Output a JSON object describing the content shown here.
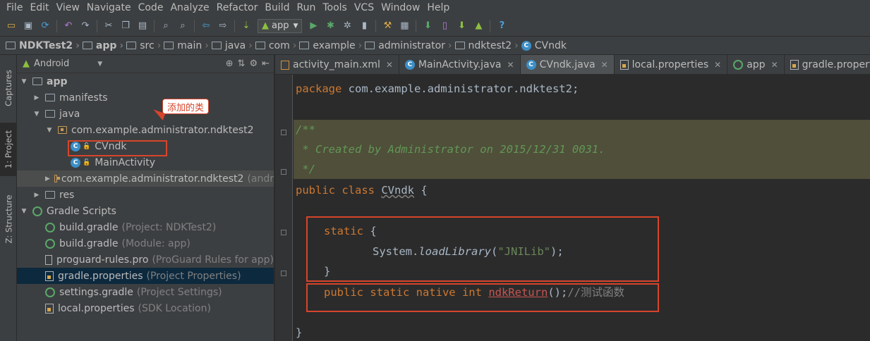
{
  "menu": [
    "File",
    "Edit",
    "View",
    "Navigate",
    "Code",
    "Analyze",
    "Refactor",
    "Build",
    "Run",
    "Tools",
    "VCS",
    "Window",
    "Help"
  ],
  "toolbar": {
    "run_config": "app",
    "help": "?"
  },
  "breadcrumbs": [
    "NDKTest2",
    "app",
    "src",
    "main",
    "java",
    "com",
    "example",
    "administrator",
    "ndktest2",
    "CVndk"
  ],
  "left_tabs": [
    "Captures",
    "1: Project",
    "Z: Structure"
  ],
  "project": {
    "view_mode": "Android",
    "tree": [
      {
        "label": "app",
        "hint": ""
      },
      {
        "label": "manifests",
        "hint": ""
      },
      {
        "label": "java",
        "hint": ""
      },
      {
        "label": "com.example.administrator.ndktest2",
        "hint": ""
      },
      {
        "label": "CVndk",
        "hint": ""
      },
      {
        "label": "MainActivity",
        "hint": ""
      },
      {
        "label": "com.example.administrator.ndktest2",
        "hint": "(andr"
      },
      {
        "label": "res",
        "hint": ""
      },
      {
        "label": "Gradle Scripts",
        "hint": ""
      },
      {
        "label": "build.gradle",
        "hint": "(Project: NDKTest2)"
      },
      {
        "label": "build.gradle",
        "hint": "(Module: app)"
      },
      {
        "label": "proguard-rules.pro",
        "hint": "(ProGuard Rules for app)"
      },
      {
        "label": "gradle.properties",
        "hint": "(Project Properties)"
      },
      {
        "label": "settings.gradle",
        "hint": "(Project Settings)"
      },
      {
        "label": "local.properties",
        "hint": "(SDK Location)"
      }
    ]
  },
  "annotation": "添加的类",
  "editor_tabs": [
    "activity_main.xml",
    "MainActivity.java",
    "CVndk.java",
    "local.properties",
    "app",
    "gradle.properties"
  ],
  "code": {
    "l1_kw": "package",
    "l1_rest": " com.example.administrator.ndktest2;",
    "l2": "/**",
    "l3": " * Created by Administrator on 2015/12/31 0031.",
    "l4": " */",
    "l5_kw": "public class",
    "l5_sp": " ",
    "l5_name": "CVndk",
    "l5_rest": " {",
    "l6_kw": "static",
    "l6_rest": " {",
    "l7_a": "System.",
    "l7_m": "loadLibrary",
    "l7_p1": "(",
    "l7_s": "\"JNILib\"",
    "l7_p2": ");",
    "l8": "}",
    "l9_kw": "public static native int",
    "l9_sp": " ",
    "l9_name": "ndkReturn",
    "l9_p": "();",
    "l9_c": "//测试函数",
    "l10": "}"
  }
}
